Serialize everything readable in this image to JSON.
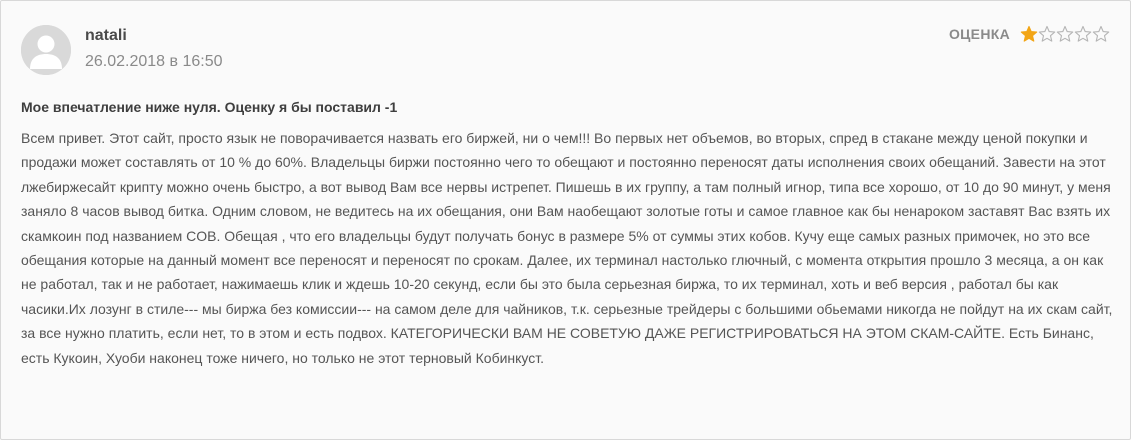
{
  "review": {
    "author": "natali",
    "date": "26.02.2018 в 16:50",
    "rating_label": "ОЦЕНКА",
    "rating_value": 1,
    "rating_max": 5,
    "title": "Мое впечатление ниже нуля. Оценку я бы поставил -1",
    "body": "Всем привет. Этот сайт, просто язык не поворачивается назвать его биржей, ни о чем!!! Во первых нет объемов, во вторых, спред в стакане между ценой покупки и продажи может составлять от 10 % до 60%. Владельцы биржи постоянно чего то обещают и постоянно переносят даты исполнения своих обещаний. Завести на этот лжебиржесайт крипту можно очень быстро, а вот вывод Вам все нервы истрепет. Пишешь в их группу, а там полный игнор, типа все хорошо, от 10 до 90 минут, у меня заняло 8 часов вывод битка. Одним словом, не ведитесь на их обещания, они Вам наобещают золотые готы и самое главное как бы ненароком заставят Вас взять их скамкоин под названием COB. Обещая , что его владельцы будут получать бонус в размере 5% от суммы этих кобов. Кучу еще самых разных примочек, но это все обещания которые на данный момент все переносят и переносят по срокам. Далее, их терминал настолько глючный, с момента открытия прошло 3 месяца, а он как не работал, так и не работает, нажимаешь клик и ждешь 10-20 секунд, если бы это была серьезная биржа, то их терминал, хоть и веб версия , работал бы как часики.Их лозунг в стиле--- мы биржа без комиссии--- на самом деле для чайников, т.к. серьезные трейдеры с большими обьемами никогда не пойдут на их скам сайт, за все нужно платить, если нет, то в этом и есть подвох. КАТЕГОРИЧЕСКИ ВАМ НЕ СОВЕТУЮ ДАЖЕ РЕГИСТРИРОВАТЬСЯ НА ЭТОМ СКАМ-САЙТЕ. Есть Бинанс, есть Кукоин, Хуоби наконец тоже ничего, но только не этот терновый Кобинкуст."
  },
  "colors": {
    "star_filled": "#f2a516",
    "star_empty_stroke": "#b5b5b5",
    "avatar_bg": "#d9d9d9",
    "avatar_fg": "#ffffff"
  },
  "icons": {
    "avatar": "user-silhouette-icon",
    "star_filled": "star-filled-icon",
    "star_empty": "star-outline-icon"
  }
}
